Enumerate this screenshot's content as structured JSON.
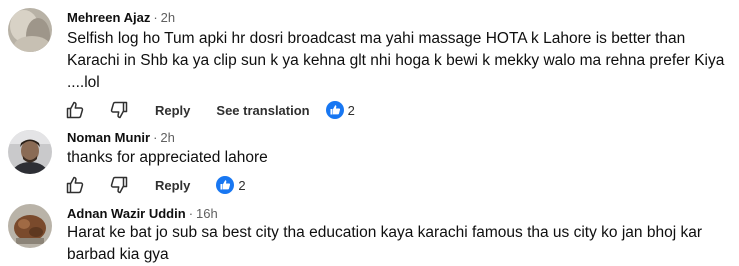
{
  "comments": [
    {
      "author": "Mehreen Ajaz",
      "time": "2h",
      "text": "Selfish log ho Tum apki hr dosri broadcast ma yahi massage HOTA k Lahore is better than Karachi in Shb ka ya clip sun k ya kehna glt nhi hoga k bewi k mekky walo ma rehna prefer Kiya ....lol",
      "reply_label": "Reply",
      "translate_label": "See translation",
      "reaction_count": "2"
    },
    {
      "author": "Noman Munir",
      "time": "2h",
      "text": "thanks for appreciated lahore",
      "reply_label": "Reply",
      "reaction_count": "2"
    },
    {
      "author": "Adnan Wazir Uddin",
      "time": "16h",
      "text": "Harat ke bat jo sub sa best city tha education kaya karachi famous tha us city ko jan bhoj kar barbad kia gya"
    }
  ],
  "separator": "·",
  "icons": {
    "like": "thumbs-up-icon",
    "dislike": "thumbs-down-icon",
    "reaction": "like-reaction-icon"
  },
  "colors": {
    "text": "#0f0f0f",
    "meta": "#606060",
    "reaction_blue": "#1877f2"
  }
}
